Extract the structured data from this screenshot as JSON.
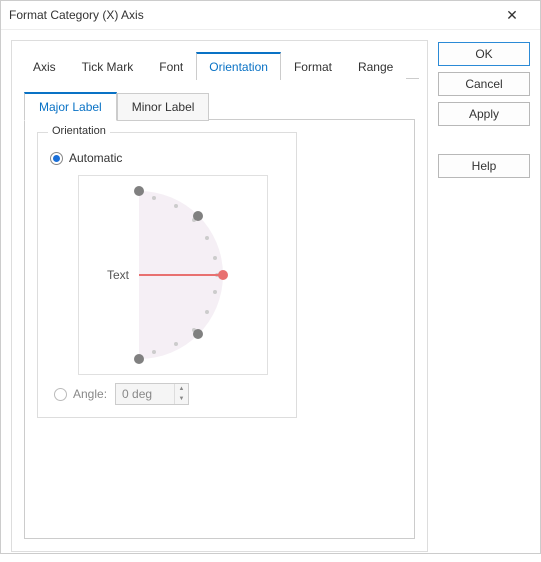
{
  "title": "Format Category (X) Axis",
  "tabs": {
    "axis": "Axis",
    "tickmark": "Tick Mark",
    "font": "Font",
    "orientation": "Orientation",
    "format": "Format",
    "range": "Range"
  },
  "subtabs": {
    "major": "Major Label",
    "minor": "Minor Label"
  },
  "group": {
    "title": "Orientation",
    "automatic": "Automatic",
    "angle_label": "Angle:",
    "angle_value": "0 deg",
    "dial_text": "Text"
  },
  "buttons": {
    "ok": "OK",
    "cancel": "Cancel",
    "apply": "Apply",
    "help": "Help"
  }
}
